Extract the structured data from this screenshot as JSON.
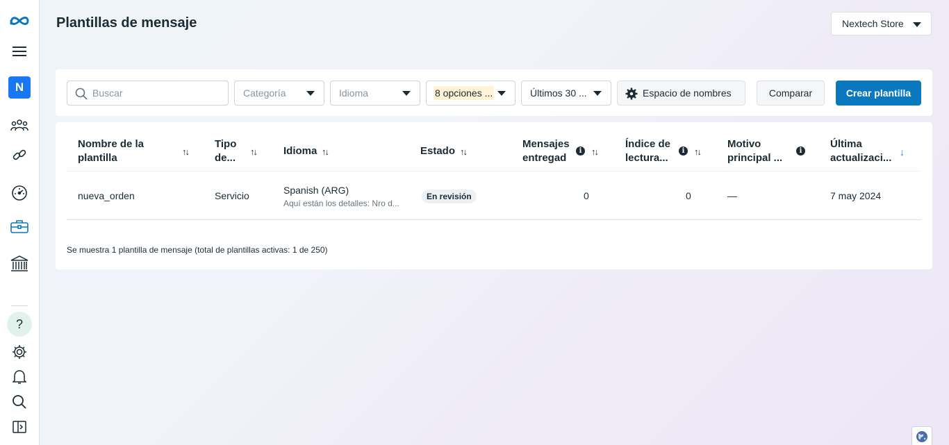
{
  "header": {
    "title": "Plantillas de mensaje",
    "account_selector": "Nextech Store"
  },
  "sidebar": {
    "avatar_letter": "N",
    "help_label": "?",
    "icons": [
      "meta-logo-icon",
      "menu-icon",
      "people-icon",
      "link-icon",
      "dashboard-gauge-icon",
      "briefcase-icon",
      "bank-icon",
      "help-icon",
      "gear-icon",
      "bell-icon",
      "search-icon",
      "collapse-panel-icon"
    ]
  },
  "filters": {
    "search_placeholder": "Buscar",
    "category": "Categoría",
    "language": "Idioma",
    "status_options": "8 opciones ...",
    "date_range": "Últimos 30 ...",
    "namespace_button": "Espacio de nombres",
    "compare_button": "Comparar",
    "create_button": "Crear plantilla"
  },
  "table": {
    "columns": [
      {
        "label_line1": "Nombre de la",
        "label_line2": "plantilla"
      },
      {
        "label_line1": "Tipo",
        "label_line2": "de..."
      },
      {
        "label_line1": "Idioma",
        "label_line2": ""
      },
      {
        "label_line1": "Estado",
        "label_line2": ""
      },
      {
        "label_line1": "Mensajes",
        "label_line2": "entregad"
      },
      {
        "label_line1": "Índice de",
        "label_line2": "lectura..."
      },
      {
        "label_line1": "Motivo",
        "label_line2": "principal ..."
      },
      {
        "label_line1": "Última",
        "label_line2": "actualizaci..."
      }
    ],
    "sort_glyph": "↑↓",
    "sort_active_glyph": "↓",
    "info_glyph": "i",
    "rows": [
      {
        "name": "nueva_orden",
        "type": "Servicio",
        "language": "Spanish (ARG)",
        "language_preview": "Aquí están los detalles: Nro d...",
        "status": "En revisión",
        "delivered": "0",
        "read_rate": "0",
        "top_reason": "—",
        "updated": "7 may 2024"
      }
    ],
    "footer": "Se muestra 1 plantilla de mensaje (total de plantillas activas: 1 de 250)"
  },
  "colors": {
    "brand_blue": "#0a78be",
    "avatar_blue": "#1877f2",
    "text": "#1c2b33",
    "highlight": "#fff3d6"
  }
}
